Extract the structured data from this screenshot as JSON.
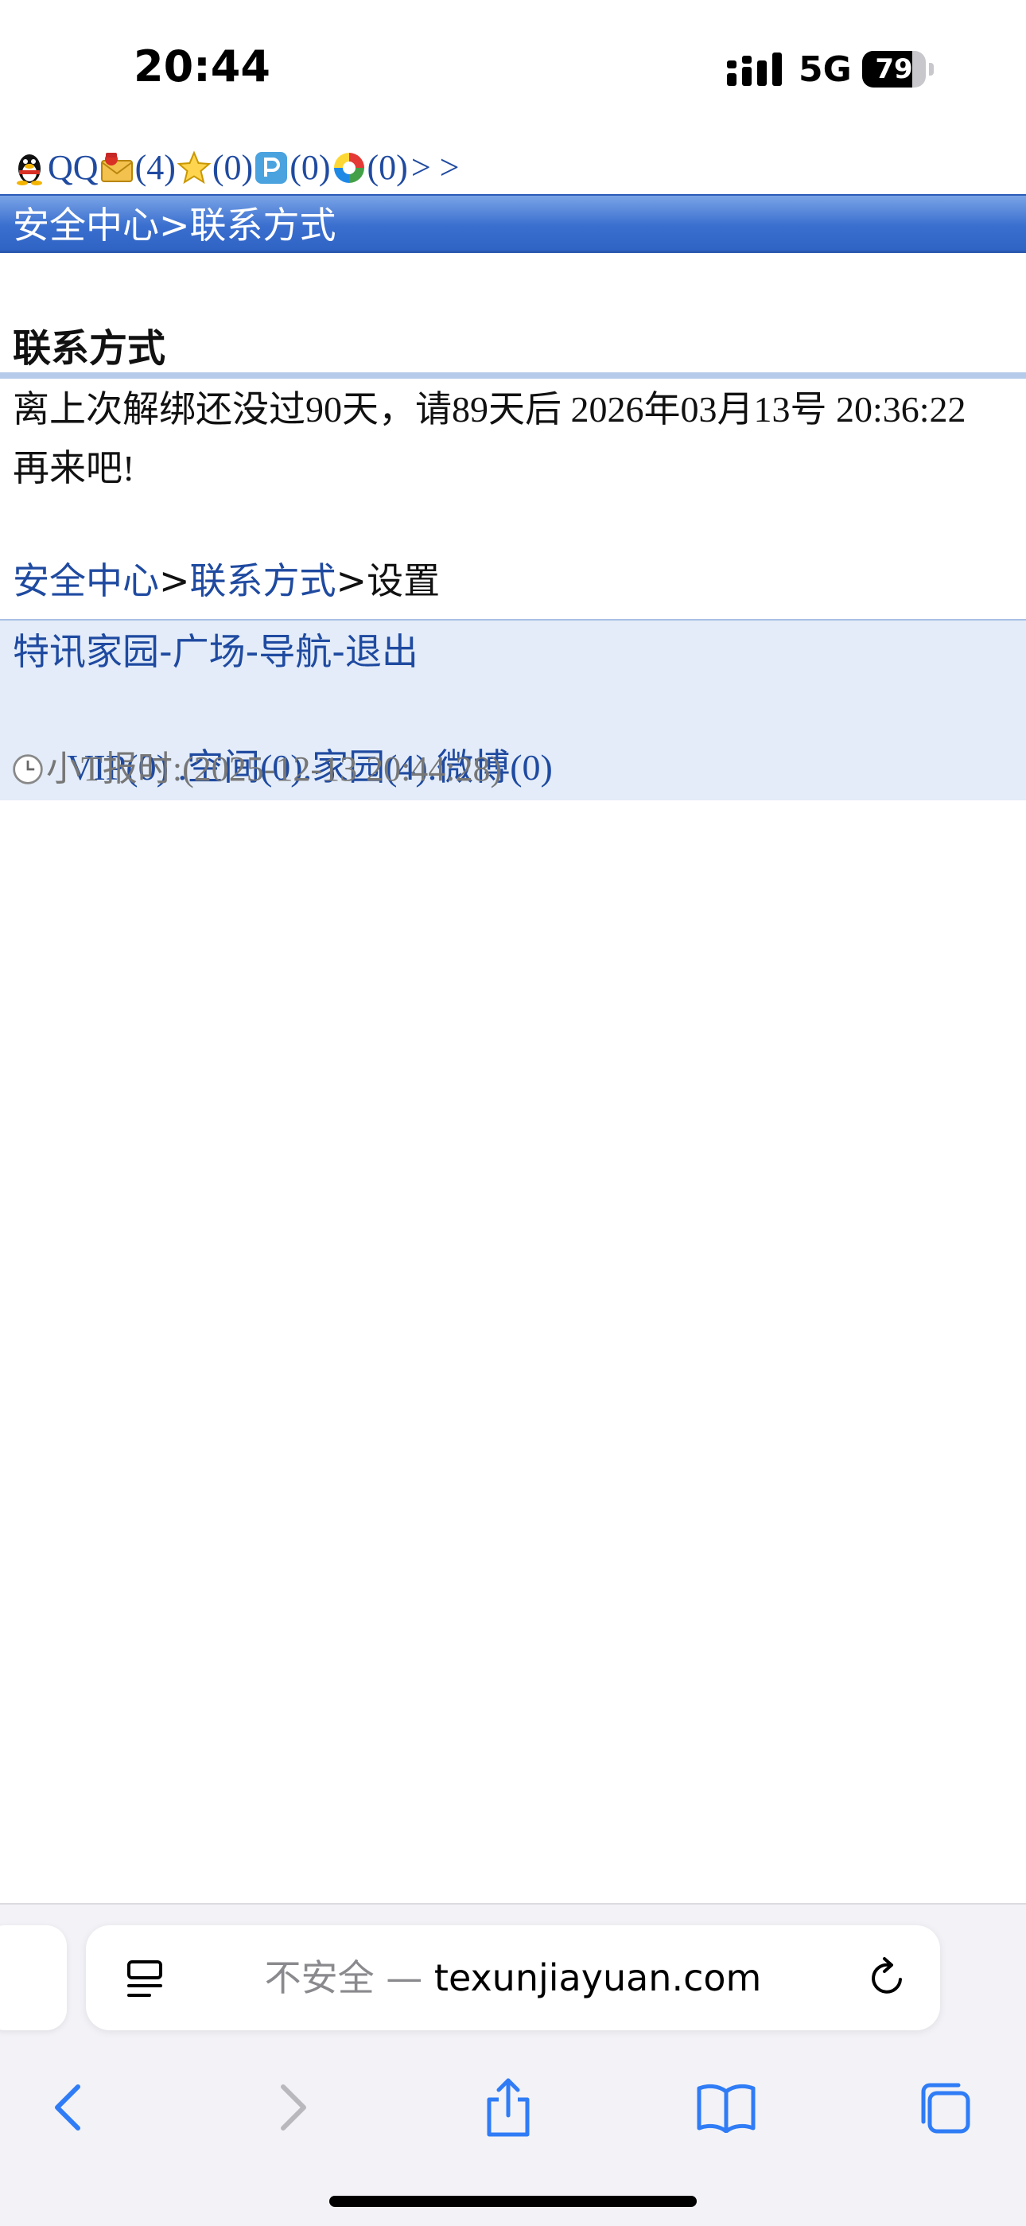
{
  "status_bar": {
    "time": "20:44",
    "network": "5G",
    "battery_level": 79,
    "battery_text": "79"
  },
  "top_links": {
    "qq_label": "QQ",
    "mail_count": "(4)",
    "favorites_count": "(0)",
    "p_count": "(0)",
    "circle_count": "(0)",
    "more": "> >"
  },
  "title_bar": {
    "text": "安全中心>联系方式"
  },
  "section": {
    "heading": "联系方式",
    "notice": "离上次解绑还没过90天，请89天后 2026年03月13号 20:36:22再来吧!"
  },
  "breadcrumb": {
    "security_center": "安全中心",
    "sep1": ">",
    "contact": "联系方式",
    "sep2": ">",
    "current": "设置"
  },
  "footer": {
    "home": "特讯家园",
    "dash1": "-",
    "plaza": "广场",
    "dash2": "-",
    "nav": "导航",
    "dash3": "-",
    "logout": "退出",
    "vip": "VIP(0)",
    "sep_a": " .",
    "space": "空间(0)",
    "sep_b": ".",
    "family": "家园(4)",
    "sep_c": ".",
    "weibo": "微博(0)",
    "time_label": "小T报时:",
    "time_value": "(2025-12-13 20:44:28)"
  },
  "browser": {
    "security_label": "不安全 —",
    "domain": "texunjiayuan.com"
  },
  "colors": {
    "link": "#1f4aa0",
    "title_bar": "#3a6fcf",
    "footer_bg": "#e3ecf8",
    "safari_blue": "#2f7cf6"
  }
}
